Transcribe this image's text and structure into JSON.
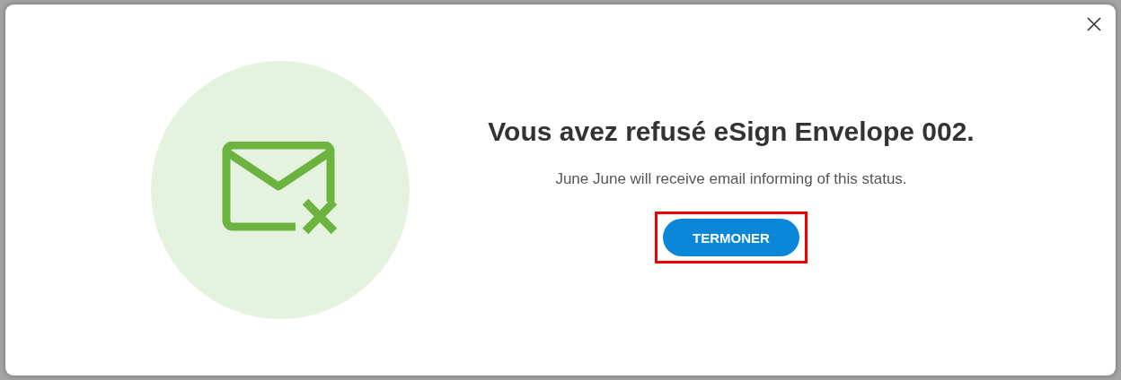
{
  "dialog": {
    "title": "Vous avez refusé eSign Envelope 002.",
    "message": "June June will receive email informing of this status.",
    "button": {
      "label": "TERMONER",
      "highlighted": true
    }
  }
}
